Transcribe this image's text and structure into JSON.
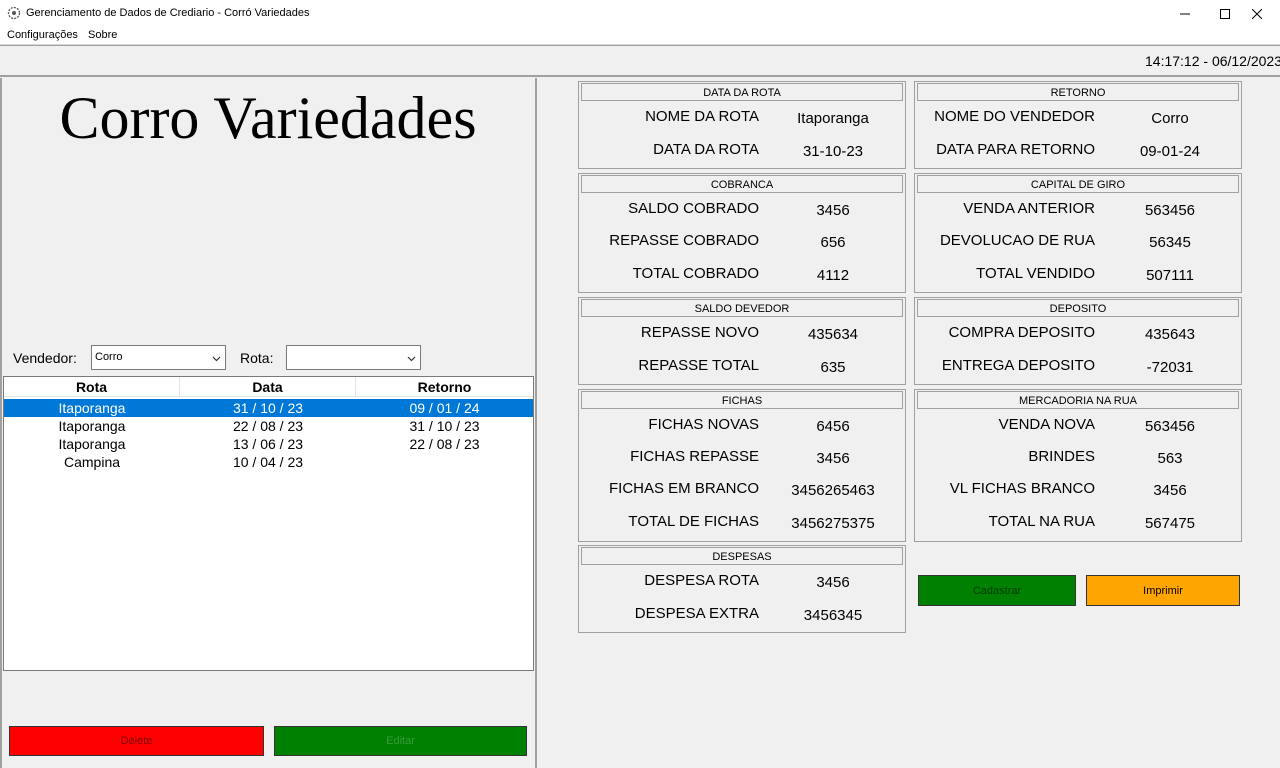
{
  "window": {
    "title": "Gerenciamento de Dados de Crediario - Corró Variedades",
    "minimize_icon": "minimize-icon",
    "maximize_icon": "maximize-icon",
    "close_icon": "close-icon"
  },
  "menu": {
    "items": [
      "Configurações",
      "Sobre"
    ]
  },
  "status": {
    "clock": "14:17:12 - 06/12/2023"
  },
  "brand": {
    "title": "Corro Variedades"
  },
  "filters": {
    "vendedor_label": "Vendedor:",
    "vendedor_value": "Corro",
    "rota_label": "Rota:",
    "rota_value": ""
  },
  "table": {
    "headers": [
      "Rota",
      "Data",
      "Retorno"
    ],
    "rows": [
      {
        "rota": "Itaporanga",
        "data": "31 / 10 / 23",
        "retorno": "09 / 01 / 24"
      },
      {
        "rota": "Itaporanga",
        "data": "22 / 08 / 23",
        "retorno": "31 / 10 / 23"
      },
      {
        "rota": "Itaporanga",
        "data": "13 / 06 / 23",
        "retorno": "22 / 08 / 23"
      },
      {
        "rota": "Campina",
        "data": "10 / 04 / 23",
        "retorno": ""
      }
    ],
    "selected_index": 0
  },
  "buttons": {
    "delete": "Delete",
    "editar": "Editar",
    "cadastrar": "Cadastrar",
    "imprimir": "Imprimir"
  },
  "colors": {
    "delete": "#ff0000",
    "green": "#008000",
    "imprimir": "#ffa500",
    "selection": "#0078d7"
  },
  "groups": {
    "data_da_rota": {
      "title": "DATA DA ROTA",
      "fields": [
        {
          "label": "NOME DA ROTA",
          "value": "Itaporanga"
        },
        {
          "label": "DATA DA ROTA",
          "value": "31-10-23"
        }
      ]
    },
    "retorno": {
      "title": "RETORNO",
      "fields": [
        {
          "label": "NOME DO VENDEDOR",
          "value": "Corro"
        },
        {
          "label": "DATA PARA RETORNO",
          "value": "09-01-24"
        }
      ]
    },
    "cobranca": {
      "title": "COBRANCA",
      "fields": [
        {
          "label": "SALDO COBRADO",
          "value": "3456"
        },
        {
          "label": "REPASSE COBRADO",
          "value": "656"
        },
        {
          "label": "TOTAL COBRADO",
          "value": "4112"
        }
      ]
    },
    "capital_de_giro": {
      "title": "CAPITAL DE GIRO",
      "fields": [
        {
          "label": "VENDA ANTERIOR",
          "value": "563456"
        },
        {
          "label": "DEVOLUCAO DE RUA",
          "value": "56345"
        },
        {
          "label": "TOTAL VENDIDO",
          "value": "507111"
        }
      ]
    },
    "saldo_devedor": {
      "title": "SALDO DEVEDOR",
      "fields": [
        {
          "label": "REPASSE NOVO",
          "value": "435634"
        },
        {
          "label": "REPASSE TOTAL",
          "value": "635"
        }
      ]
    },
    "deposito": {
      "title": "DEPOSITO",
      "fields": [
        {
          "label": "COMPRA DEPOSITO",
          "value": "435643"
        },
        {
          "label": "ENTREGA DEPOSITO",
          "value": "-72031"
        }
      ]
    },
    "fichas": {
      "title": "FICHAS",
      "fields": [
        {
          "label": "FICHAS NOVAS",
          "value": "6456"
        },
        {
          "label": "FICHAS REPASSE",
          "value": "3456"
        },
        {
          "label": "FICHAS EM BRANCO",
          "value": "3456265463"
        },
        {
          "label": "TOTAL DE FICHAS",
          "value": "3456275375"
        }
      ]
    },
    "mercadoria_na_rua": {
      "title": "MERCADORIA NA RUA",
      "fields": [
        {
          "label": "VENDA NOVA",
          "value": "563456"
        },
        {
          "label": "BRINDES",
          "value": "563"
        },
        {
          "label": "VL FICHAS BRANCO",
          "value": "3456"
        },
        {
          "label": "TOTAL NA RUA",
          "value": "567475"
        }
      ]
    },
    "despesas": {
      "title": "DESPESAS",
      "fields": [
        {
          "label": "DESPESA ROTA",
          "value": "3456"
        },
        {
          "label": "DESPESA EXTRA",
          "value": "3456345"
        }
      ]
    }
  }
}
